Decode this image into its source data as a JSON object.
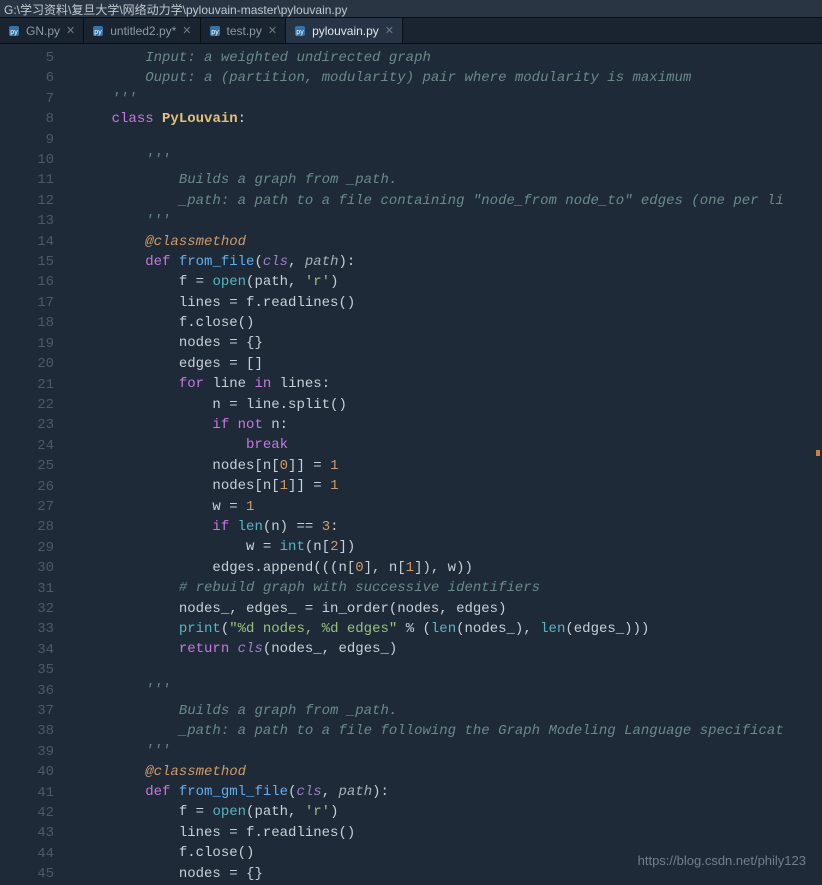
{
  "path": "G:\\学习资料\\复旦大学\\网络动力学\\pylouvain-master\\pylouvain.py",
  "tabs": [
    {
      "label": "GN.py",
      "active": false
    },
    {
      "label": "untitled2.py*",
      "active": false
    },
    {
      "label": "test.py",
      "active": false
    },
    {
      "label": "pylouvain.py",
      "active": true
    }
  ],
  "first_line": 5,
  "code_lines": [
    {
      "n": 5,
      "html": "        <span class='c-comment'>Input: a weighted undirected graph</span>"
    },
    {
      "n": 6,
      "html": "        <span class='c-comment'>Ouput: a (partition, modularity) pair where modularity is maximum</span>"
    },
    {
      "n": 7,
      "html": "    <span class='c-comment'>'''</span>"
    },
    {
      "n": 8,
      "html": "    <span class='c-kw'>class</span> <span class='c-cls'>PyLouvain</span><span class='c-punc'>:</span>"
    },
    {
      "n": 9,
      "html": ""
    },
    {
      "n": 10,
      "html": "        <span class='c-comment'>'''</span>"
    },
    {
      "n": 11,
      "html": "            <span class='c-comment'>Builds a graph from _path.</span>"
    },
    {
      "n": 12,
      "html": "            <span class='c-comment'>_path: a path to a file containing \"node_from node_to\" edges (one per li</span>"
    },
    {
      "n": 13,
      "html": "        <span class='c-comment'>'''</span>"
    },
    {
      "n": 14,
      "html": "        <span class='c-deco'>@classmethod</span>"
    },
    {
      "n": 15,
      "html": "        <span class='c-def'>def</span> <span class='c-fn'>from_file</span>(<span class='c-self'>cls</span>, <span class='c-param'>path</span>):"
    },
    {
      "n": 16,
      "html": "            f <span class='c-op'>=</span> <span class='c-builtin'>open</span>(path, <span class='c-strlit'>'r'</span>)"
    },
    {
      "n": 17,
      "html": "            lines <span class='c-op'>=</span> f.readlines()"
    },
    {
      "n": 18,
      "html": "            f.close()"
    },
    {
      "n": 19,
      "html": "            nodes <span class='c-op'>=</span> {}"
    },
    {
      "n": 20,
      "html": "            edges <span class='c-op'>=</span> []"
    },
    {
      "n": 21,
      "html": "            <span class='c-kw'>for</span> line <span class='c-kw'>in</span> lines:"
    },
    {
      "n": 22,
      "html": "                n <span class='c-op'>=</span> line.split()"
    },
    {
      "n": 23,
      "html": "                <span class='c-kw'>if</span> <span class='c-kw'>not</span> n:"
    },
    {
      "n": 24,
      "html": "                    <span class='c-kw'>break</span>"
    },
    {
      "n": 25,
      "html": "                nodes[n[<span class='c-num'>0</span>]] <span class='c-op'>=</span> <span class='c-num'>1</span>"
    },
    {
      "n": 26,
      "html": "                nodes[n[<span class='c-num'>1</span>]] <span class='c-op'>=</span> <span class='c-num'>1</span>"
    },
    {
      "n": 27,
      "html": "                w <span class='c-op'>=</span> <span class='c-num'>1</span>"
    },
    {
      "n": 28,
      "html": "                <span class='c-kw'>if</span> <span class='c-builtin'>len</span>(n) <span class='c-op'>==</span> <span class='c-num'>3</span>:"
    },
    {
      "n": 29,
      "html": "                    w <span class='c-op'>=</span> <span class='c-builtin'>int</span>(n[<span class='c-num'>2</span>])"
    },
    {
      "n": 30,
      "html": "                edges.append(((n[<span class='c-num'>0</span>], n[<span class='c-num'>1</span>]), w))"
    },
    {
      "n": 31,
      "html": "            <span class='c-comment'># rebuild graph with successive identifiers</span>"
    },
    {
      "n": 32,
      "html": "            nodes_, edges_ <span class='c-op'>=</span> in_order(nodes, edges)"
    },
    {
      "n": 33,
      "html": "            <span class='c-builtin'>print</span>(<span class='c-strlit'>\"%d nodes, %d edges\"</span> <span class='c-op'>%</span> (<span class='c-builtin'>len</span>(nodes_), <span class='c-builtin'>len</span>(edges_)))"
    },
    {
      "n": 34,
      "html": "            <span class='c-kw'>return</span> <span class='c-self'>cls</span>(nodes_, edges_)"
    },
    {
      "n": 35,
      "html": ""
    },
    {
      "n": 36,
      "html": "        <span class='c-comment'>'''</span>"
    },
    {
      "n": 37,
      "html": "            <span class='c-comment'>Builds a graph from _path.</span>"
    },
    {
      "n": 38,
      "html": "            <span class='c-comment'>_path: a path to a file following the Graph Modeling Language specificat</span>"
    },
    {
      "n": 39,
      "html": "        <span class='c-comment'>'''</span>"
    },
    {
      "n": 40,
      "html": "        <span class='c-deco'>@classmethod</span>"
    },
    {
      "n": 41,
      "html": "        <span class='c-def'>def</span> <span class='c-fn'>from_gml_file</span>(<span class='c-self'>cls</span>, <span class='c-param'>path</span>):"
    },
    {
      "n": 42,
      "html": "            f <span class='c-op'>=</span> <span class='c-builtin'>open</span>(path, <span class='c-strlit'>'r'</span>)"
    },
    {
      "n": 43,
      "html": "            lines <span class='c-op'>=</span> f.readlines()"
    },
    {
      "n": 44,
      "html": "            f.close()"
    },
    {
      "n": 45,
      "html": "            nodes <span class='c-op'>=</span> {}"
    }
  ],
  "watermark": "https://blog.csdn.net/phily123"
}
